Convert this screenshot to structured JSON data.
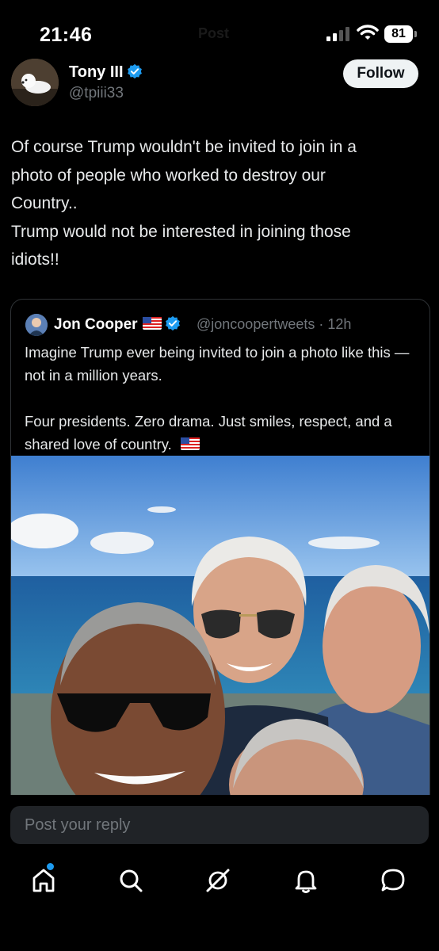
{
  "status_bar": {
    "time": "21:46",
    "header_title": "Post",
    "battery_level": "81"
  },
  "post": {
    "author": {
      "name": "Tony III",
      "handle": "@tpiii33",
      "verified": true
    },
    "follow_label": "Follow",
    "text_lines": [
      "Of course Trump wouldn't be invited to join in a",
      "photo of people who worked to destroy our",
      "Country..",
      "Trump would not be interested in joining those",
      "idiots!!"
    ]
  },
  "quoted_post": {
    "author_name": "Jon Cooper",
    "handle": "@joncoopertweets",
    "separator": "·",
    "time_ago": "12h",
    "paragraph_1": "Imagine Trump ever being invited to join a photo like this — not in a million years.",
    "paragraph_2": "Four presidents. Zero drama. Just smiles, respect, and a shared love of country."
  },
  "reply": {
    "placeholder": "Post your reply"
  },
  "nav": {
    "items": [
      "home-icon",
      "search-icon",
      "grok-icon",
      "notifications-icon",
      "messages-icon"
    ],
    "has_home_notification": true
  },
  "colors": {
    "background": "#000000",
    "accent": "#1d9bf0",
    "muted_text": "#71767b",
    "border": "#2f3336"
  }
}
